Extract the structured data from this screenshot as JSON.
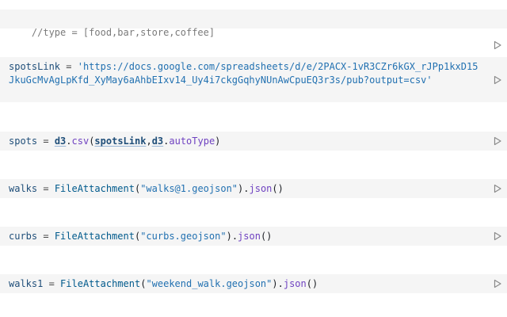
{
  "cells": {
    "type_comment": {
      "comment": "//type = [food,bar,store,coffee]"
    },
    "spots_link": {
      "name": "spotsLink",
      "op": " = ",
      "value": "'https://docs.google.com/spreadsheets/d/e/2PACX-1vR3CZr6kGX_rJPp1kxD15JkuGcMvAgLpKfd_XyMay6aAhbEIxv14_Uy4i7ckgGqhyNUnAwCpuEQ3r3s/pub?output=csv'"
    },
    "spots": {
      "name": "spots",
      "op": " = ",
      "obj": "d3",
      "dot1": ".",
      "method": "csv",
      "open": "(",
      "arg1": "spotsLink",
      "comma": ",",
      "arg2_obj": "d3",
      "dot2": ".",
      "arg2_prop": "autoType",
      "close": ")"
    },
    "walks": {
      "name": "walks",
      "op": " = ",
      "func": "FileAttachment",
      "open": "(",
      "arg": "\"walks@1.geojson\"",
      "close": ")",
      "dot": ".",
      "method": "json",
      "call": "()"
    },
    "curbs": {
      "name": "curbs",
      "op": " = ",
      "func": "FileAttachment",
      "open": "(",
      "arg": "\"curbs.geojson\"",
      "close": ")",
      "dot": ".",
      "method": "json",
      "call": "()"
    },
    "walks1": {
      "name": "walks1",
      "op": " = ",
      "func": "FileAttachment",
      "open": "(",
      "arg": "\"weekend_walk.geojson\"",
      "close": ")",
      "dot": ".",
      "method": "json",
      "call": "()"
    }
  },
  "icons": {
    "run": "play-outline-icon"
  },
  "colors": {
    "cell_background": "#f5f5f5",
    "string": "#2271b1",
    "variable": "#1f4e79",
    "method": "#6f42c1",
    "comment": "#7a7a7a"
  }
}
